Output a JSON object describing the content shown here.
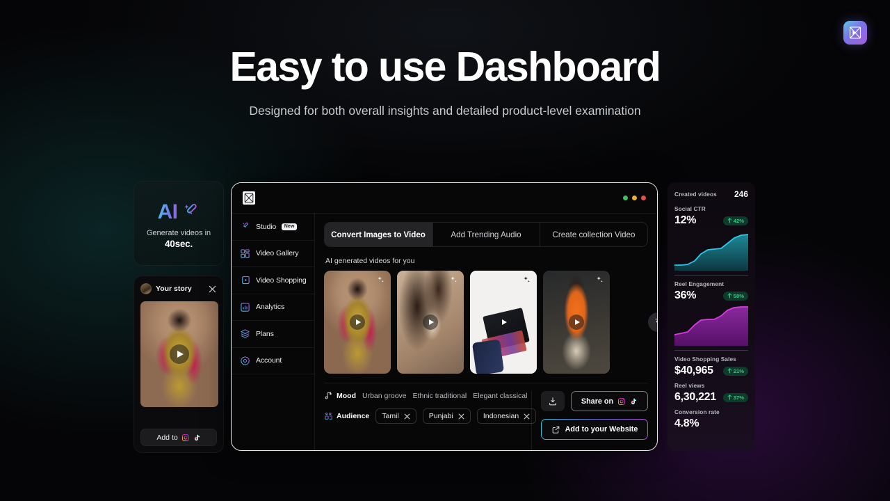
{
  "page": {
    "headline": "Easy to use Dashboard",
    "subhead": "Designed for both overall insights and detailed product-level examination",
    "brand_logo_icon": "brand-logo-icon",
    "accent_cyan": "#31c6dd",
    "accent_purple": "#a94fd8",
    "accent_green": "#25d07f",
    "background": "#050507"
  },
  "left": {
    "ai_card": {
      "title": "AI",
      "wand_icon": "magic-wand-icon",
      "line1": "Generate videos in",
      "line2": "40sec."
    },
    "story_card": {
      "avatar_icon": "avatar",
      "title": "Your story",
      "close_icon": "close-icon",
      "play_icon": "play-icon",
      "add_to_label": "Add to",
      "instagram_icon": "instagram-icon",
      "tiktok_icon": "tiktok-icon"
    }
  },
  "window": {
    "logo_icon": "app-logo-icon",
    "traffic_lights": [
      "green",
      "yellow",
      "red"
    ],
    "sidebar": {
      "items": [
        {
          "label": "Studio",
          "icon": "magic-wand-icon",
          "badge": "New"
        },
        {
          "label": "Video Gallery",
          "icon": "grid-icon",
          "badge": ""
        },
        {
          "label": "Video Shopping",
          "icon": "video-player-icon",
          "badge": ""
        },
        {
          "label": "Analytics",
          "icon": "bar-chart-icon",
          "badge": ""
        },
        {
          "label": "Plans",
          "icon": "layers-icon",
          "badge": ""
        },
        {
          "label": "Account",
          "icon": "gear-icon",
          "badge": ""
        }
      ]
    },
    "tabs": [
      {
        "label": "Convert Images to Video",
        "active": true
      },
      {
        "label": "Add Trending Audio",
        "active": false
      },
      {
        "label": "Create collection Video",
        "active": false
      }
    ],
    "section_label": "AI generated videos for you",
    "videos": [
      {
        "name": "bridal-lehenga-video",
        "sparkle_icon": "sparkle-icon",
        "play_icon": "play-icon"
      },
      {
        "name": "earring-closeup-video",
        "sparkle_icon": "sparkle-icon",
        "play_icon": "play-icon"
      },
      {
        "name": "makeup-palette-video",
        "sparkle_icon": "sparkle-icon",
        "play_icon": "play-icon"
      },
      {
        "name": "orange-kurta-video",
        "sparkle_icon": "sparkle-icon",
        "play_icon": "play-icon"
      }
    ],
    "wand_fab_icon": "magic-wand-icon",
    "controls": {
      "mood": {
        "icon": "music-note-icon",
        "label": "Mood",
        "options": [
          "Urban groove",
          "Ethnic traditional",
          "Elegant classical"
        ]
      },
      "audience": {
        "icon": "audience-icon",
        "label": "Audience",
        "chips": [
          "Tamil",
          "Punjabi",
          "Indonesian"
        ],
        "chip_remove_icon": "close-icon"
      },
      "download_icon": "download-icon",
      "share_label": "Share on",
      "share_instagram_icon": "instagram-icon",
      "share_tiktok_icon": "tiktok-icon",
      "website_label": "Add to your Website",
      "website_icon": "external-link-icon"
    }
  },
  "stats": {
    "created_videos_label": "Created videos",
    "created_videos_value": "246",
    "items": [
      {
        "label": "Social CTR",
        "value": "12%",
        "delta": "42%",
        "delta_icon": "arrow-up-icon"
      },
      {
        "label": "Reel Engagement",
        "value": "36%",
        "delta": "58%",
        "delta_icon": "arrow-up-icon"
      },
      {
        "label": "Video Shopping Sales",
        "value": "$40,965",
        "delta": "21%",
        "delta_icon": "arrow-up-icon"
      },
      {
        "label": "Reel views",
        "value": "6,30,221",
        "delta": "37%",
        "delta_icon": "arrow-up-icon"
      },
      {
        "label": "Conversion rate",
        "value": "4.8%",
        "delta": "",
        "delta_icon": ""
      }
    ]
  },
  "chart_data": [
    {
      "type": "area",
      "title": "Social CTR",
      "series": [
        {
          "name": "Social CTR",
          "values": [
            14,
            14,
            15,
            20,
            36,
            45,
            47,
            48,
            60,
            74,
            82,
            85
          ]
        }
      ],
      "x": [
        1,
        2,
        3,
        4,
        5,
        6,
        7,
        8,
        9,
        10,
        11,
        12
      ],
      "line_color": "#2fc7e8",
      "fill_color": "#0f4f5c",
      "ylim": [
        0,
        100
      ],
      "grid": false,
      "legend": "none"
    },
    {
      "type": "area",
      "title": "Reel Engagement",
      "series": [
        {
          "name": "Reel Engagement",
          "values": [
            28,
            30,
            32,
            44,
            56,
            58,
            58,
            66,
            80,
            90,
            93,
            94
          ]
        }
      ],
      "x": [
        1,
        2,
        3,
        4,
        5,
        6,
        7,
        8,
        9,
        10,
        11,
        12
      ],
      "line_color": "#c738d8",
      "fill_color": "#6d1580",
      "ylim": [
        0,
        100
      ],
      "grid": false,
      "legend": "none"
    }
  ]
}
